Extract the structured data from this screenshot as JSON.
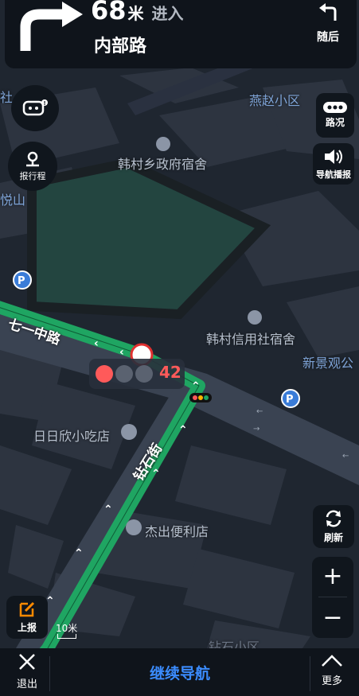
{
  "banner": {
    "distance": "68",
    "distance_unit": "米",
    "action": "进入",
    "road_name": "内部路",
    "next_turn_label": "随后"
  },
  "map_labels": {
    "yanzhao": "燕赵小区",
    "hancun_gov": "韩村乡政府宿舍",
    "yueshan": "悦山",
    "road_qiyi": "七一中路",
    "hancun_credit": "韩村信用社宿舍",
    "xinjingguan": "新景观公",
    "riri": "日日欣小吃店",
    "zuanshi": "钻石街",
    "jiechu": "杰出便利店",
    "zuanshi_area": "钻石小区",
    "she": "社"
  },
  "controls": {
    "report_trip": "报行程",
    "traffic": "路况",
    "voice": "导航播报",
    "refresh": "刷新",
    "report": "上报",
    "zoom_in": "+",
    "zoom_out": "−"
  },
  "traffic_light": {
    "countdown": "42",
    "active": "red"
  },
  "scale": {
    "label": "10米"
  },
  "bottom": {
    "exit": "退出",
    "continue": "继续导航",
    "more": "更多"
  },
  "colors": {
    "route_green": "#1fa562",
    "accent_blue": "#3b8cff",
    "report_orange": "#ff8a00",
    "traffic_red": "#ff5a5a"
  }
}
